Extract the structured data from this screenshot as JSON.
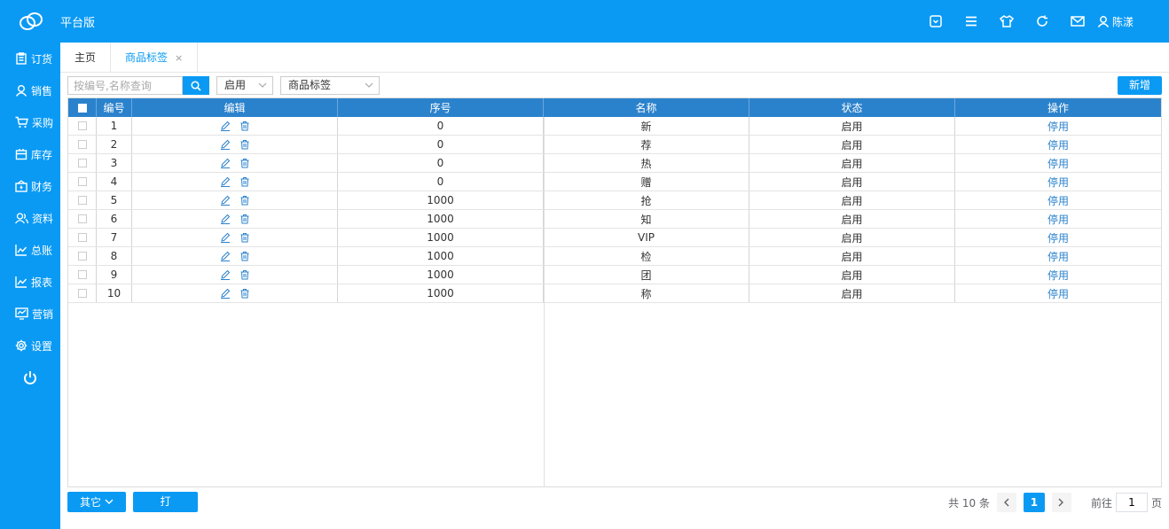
{
  "app": {
    "title": "平台版"
  },
  "header": {
    "user_name": "陈漾",
    "icons": [
      "dropdown-box-icon",
      "menu-icon",
      "shirt-icon",
      "refresh-icon",
      "mail-icon",
      "user-icon"
    ]
  },
  "sidebar": {
    "items": [
      {
        "label": "订货",
        "icon": "clipboard-icon"
      },
      {
        "label": "销售",
        "icon": "person-icon"
      },
      {
        "label": "采购",
        "icon": "cart-icon"
      },
      {
        "label": "库存",
        "icon": "box-icon"
      },
      {
        "label": "财务",
        "icon": "wallet-icon"
      },
      {
        "label": "资料",
        "icon": "people-icon"
      },
      {
        "label": "总账",
        "icon": "chart-icon"
      },
      {
        "label": "报表",
        "icon": "chart-icon"
      },
      {
        "label": "营销",
        "icon": "monitor-chart-icon"
      },
      {
        "label": "设置",
        "icon": "gear-icon"
      }
    ]
  },
  "tabs": [
    {
      "label": "主页"
    },
    {
      "label": "商品标签",
      "close": "×"
    }
  ],
  "toolbar": {
    "search_placeholder": "按编号,名称查询",
    "status_select": "启用",
    "type_select": "商品标签",
    "new_button": "新增"
  },
  "table": {
    "headers": {
      "no": "编号",
      "edit": "编辑",
      "order": "序号",
      "name": "名称",
      "status": "状态",
      "op": "操作"
    },
    "rows": [
      {
        "no": "1",
        "order": "0",
        "name": "新",
        "status": "启用",
        "op": "停用"
      },
      {
        "no": "2",
        "order": "0",
        "name": "荐",
        "status": "启用",
        "op": "停用"
      },
      {
        "no": "3",
        "order": "0",
        "name": "热",
        "status": "启用",
        "op": "停用"
      },
      {
        "no": "4",
        "order": "0",
        "name": "赠",
        "status": "启用",
        "op": "停用"
      },
      {
        "no": "5",
        "order": "1000",
        "name": "抢",
        "status": "启用",
        "op": "停用"
      },
      {
        "no": "6",
        "order": "1000",
        "name": "知",
        "status": "启用",
        "op": "停用"
      },
      {
        "no": "7",
        "order": "1000",
        "name": "VIP",
        "status": "启用",
        "op": "停用"
      },
      {
        "no": "8",
        "order": "1000",
        "name": "检",
        "status": "启用",
        "op": "停用"
      },
      {
        "no": "9",
        "order": "1000",
        "name": "团",
        "status": "启用",
        "op": "停用"
      },
      {
        "no": "10",
        "order": "1000",
        "name": "称",
        "status": "启用",
        "op": "停用"
      }
    ]
  },
  "footer": {
    "other_button": "其它",
    "print_button": "打印",
    "total_text": "共 10 条",
    "current_page": "1",
    "goto_label": "前往",
    "goto_value": "1",
    "page_suffix": "页"
  },
  "colors": {
    "brand": "#0a9af4",
    "table_header": "#2b82cc"
  }
}
